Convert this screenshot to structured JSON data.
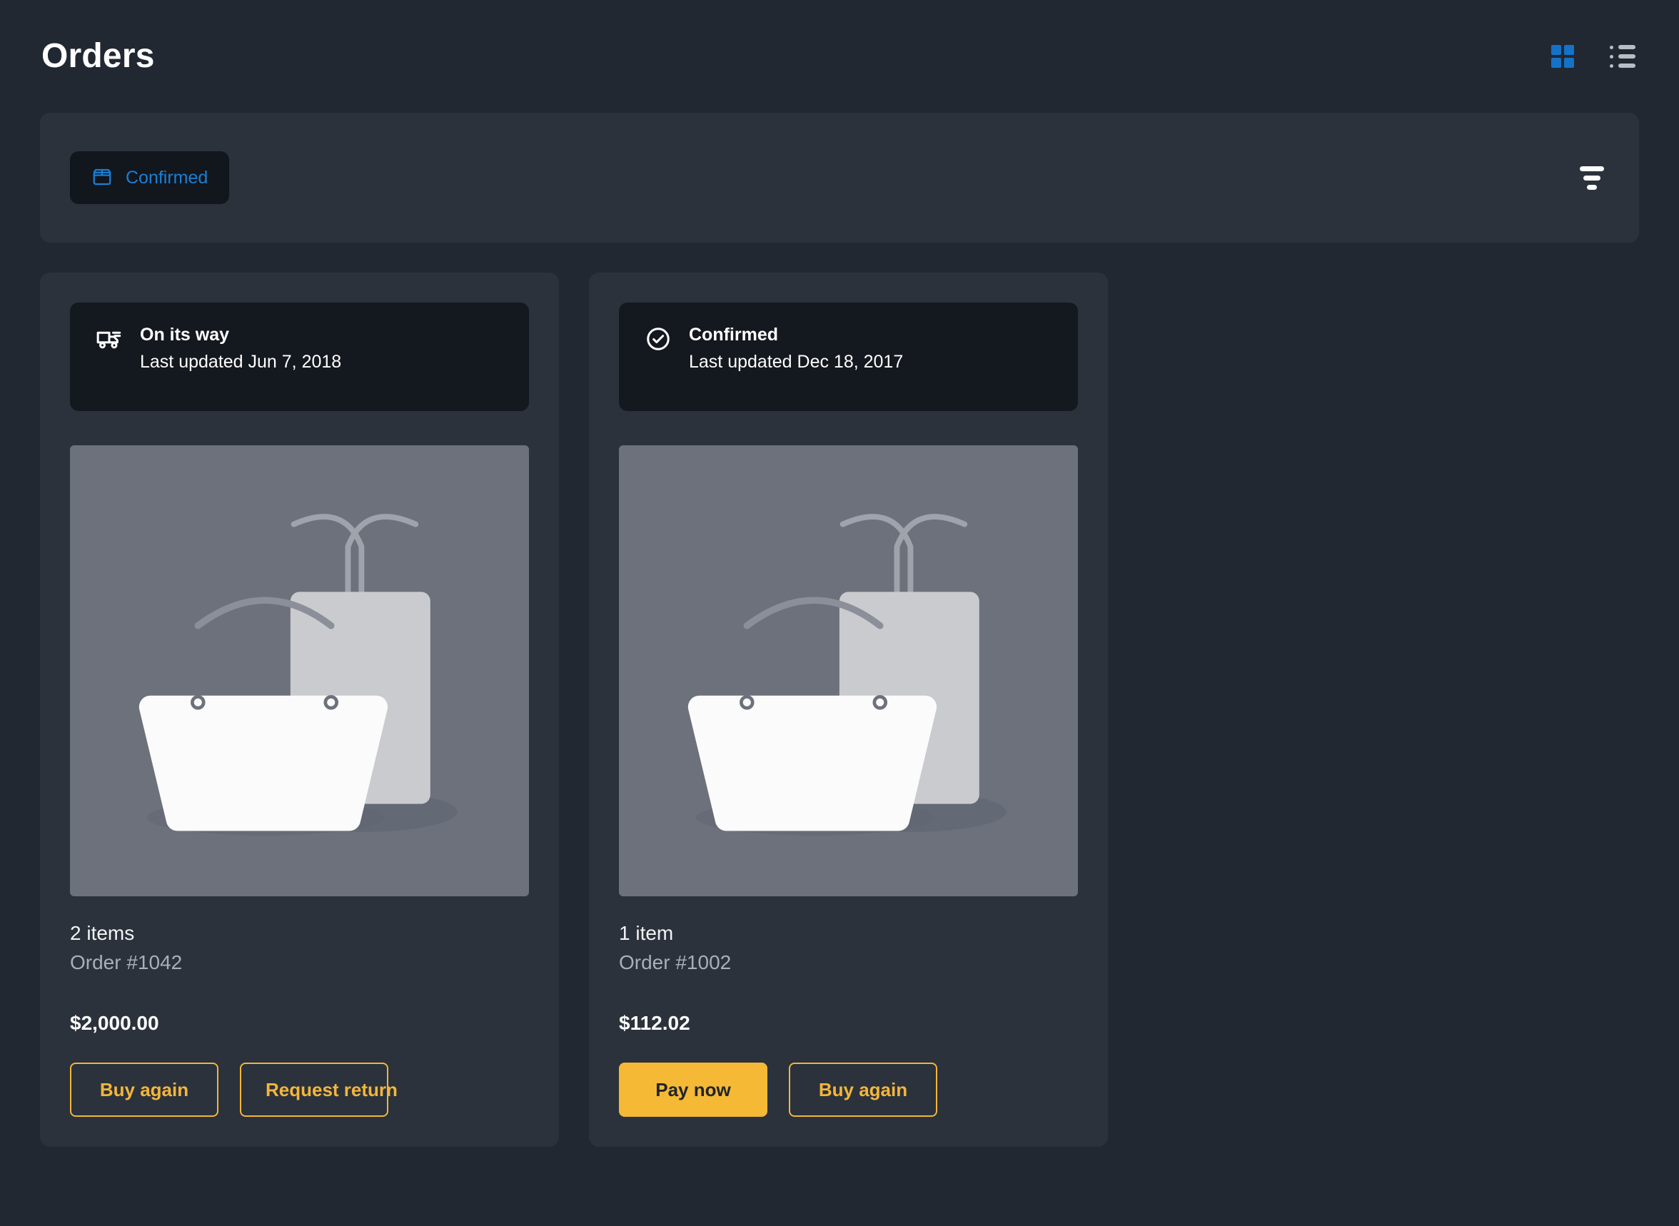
{
  "header": {
    "title": "Orders",
    "view_toggles": [
      {
        "name": "grid-view",
        "icon": "grid-icon",
        "active": true,
        "color": "#1572C9"
      },
      {
        "name": "list-view",
        "icon": "list-icon",
        "active": false,
        "color": "#B9BEC6"
      }
    ]
  },
  "filter_bar": {
    "chip": {
      "label": "Confirmed",
      "icon": "package-icon",
      "color": "#1B7FD4"
    },
    "filter_button": {
      "icon": "funnel-icon"
    }
  },
  "orders": [
    {
      "status": {
        "icon": "truck-icon",
        "title": "On its way",
        "updated": "Last updated Jun 7, 2018"
      },
      "image": {
        "icon": "shopping-bags-placeholder",
        "bg": "#6C717C"
      },
      "item_count": "2 items",
      "order_number": "Order #1042",
      "total": "$2,000.00",
      "actions": [
        {
          "label": "Buy again",
          "style": "outline"
        },
        {
          "label": "Request return",
          "style": "outline"
        }
      ]
    },
    {
      "status": {
        "icon": "check-circle-icon",
        "title": "Confirmed",
        "updated": "Last updated Dec 18, 2017"
      },
      "image": {
        "icon": "shopping-bags-placeholder",
        "bg": "#6C717C"
      },
      "item_count": "1 item",
      "order_number": "Order #1002",
      "total": "$112.02",
      "actions": [
        {
          "label": "Pay now",
          "style": "filled"
        },
        {
          "label": "Buy again",
          "style": "outline"
        }
      ]
    }
  ],
  "colors": {
    "page_bg": "#222831",
    "card_bg": "#2B323C",
    "banner_bg": "#14181F",
    "chip_bg": "#12161D",
    "accent_blue": "#1B7FD4",
    "accent_amber": "#F5B936",
    "text_primary": "#FFFFFF",
    "text_muted": "#A9AFB9"
  }
}
